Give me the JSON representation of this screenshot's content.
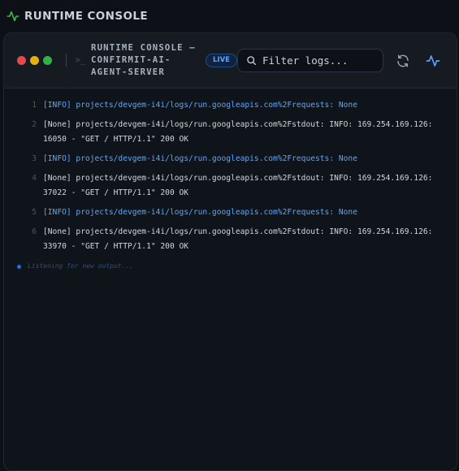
{
  "header": {
    "title": "RUNTIME CONSOLE"
  },
  "console": {
    "title": "RUNTIME CONSOLE — CONFIRMIT-AI-AGENT-SERVER",
    "live_label": "LIVE",
    "search_placeholder": "Filter logs...",
    "listening_text": "Listening for new output..."
  },
  "logs": [
    {
      "n": "1",
      "level": "info",
      "text": "[INFO] projects/devgem-i4i/logs/run.googleapis.com%2Frequests: None"
    },
    {
      "n": "2",
      "level": "none",
      "text": "[None] projects/devgem-i4i/logs/run.googleapis.com%2Fstdout: INFO: 169.254.169.126:16050 - \"GET / HTTP/1.1\" 200 OK"
    },
    {
      "n": "3",
      "level": "info",
      "text": "[INFO] projects/devgem-i4i/logs/run.googleapis.com%2Frequests: None"
    },
    {
      "n": "4",
      "level": "none",
      "text": "[None] projects/devgem-i4i/logs/run.googleapis.com%2Fstdout: INFO: 169.254.169.126:37022 - \"GET / HTTP/1.1\" 200 OK"
    },
    {
      "n": "5",
      "level": "info",
      "text": "[INFO] projects/devgem-i4i/logs/run.googleapis.com%2Frequests: None"
    },
    {
      "n": "6",
      "level": "none",
      "text": "[None] projects/devgem-i4i/logs/run.googleapis.com%2Fstdout: INFO: 169.254.169.126:33970 - \"GET / HTTP/1.1\" 200 OK"
    }
  ],
  "colors": {
    "accent": "#58a6ff",
    "pulse": "#3fb950",
    "background": "#0d1117"
  },
  "icons": [
    "activity-icon",
    "terminal-icon",
    "search-icon",
    "refresh-icon",
    "activity-icon"
  ]
}
